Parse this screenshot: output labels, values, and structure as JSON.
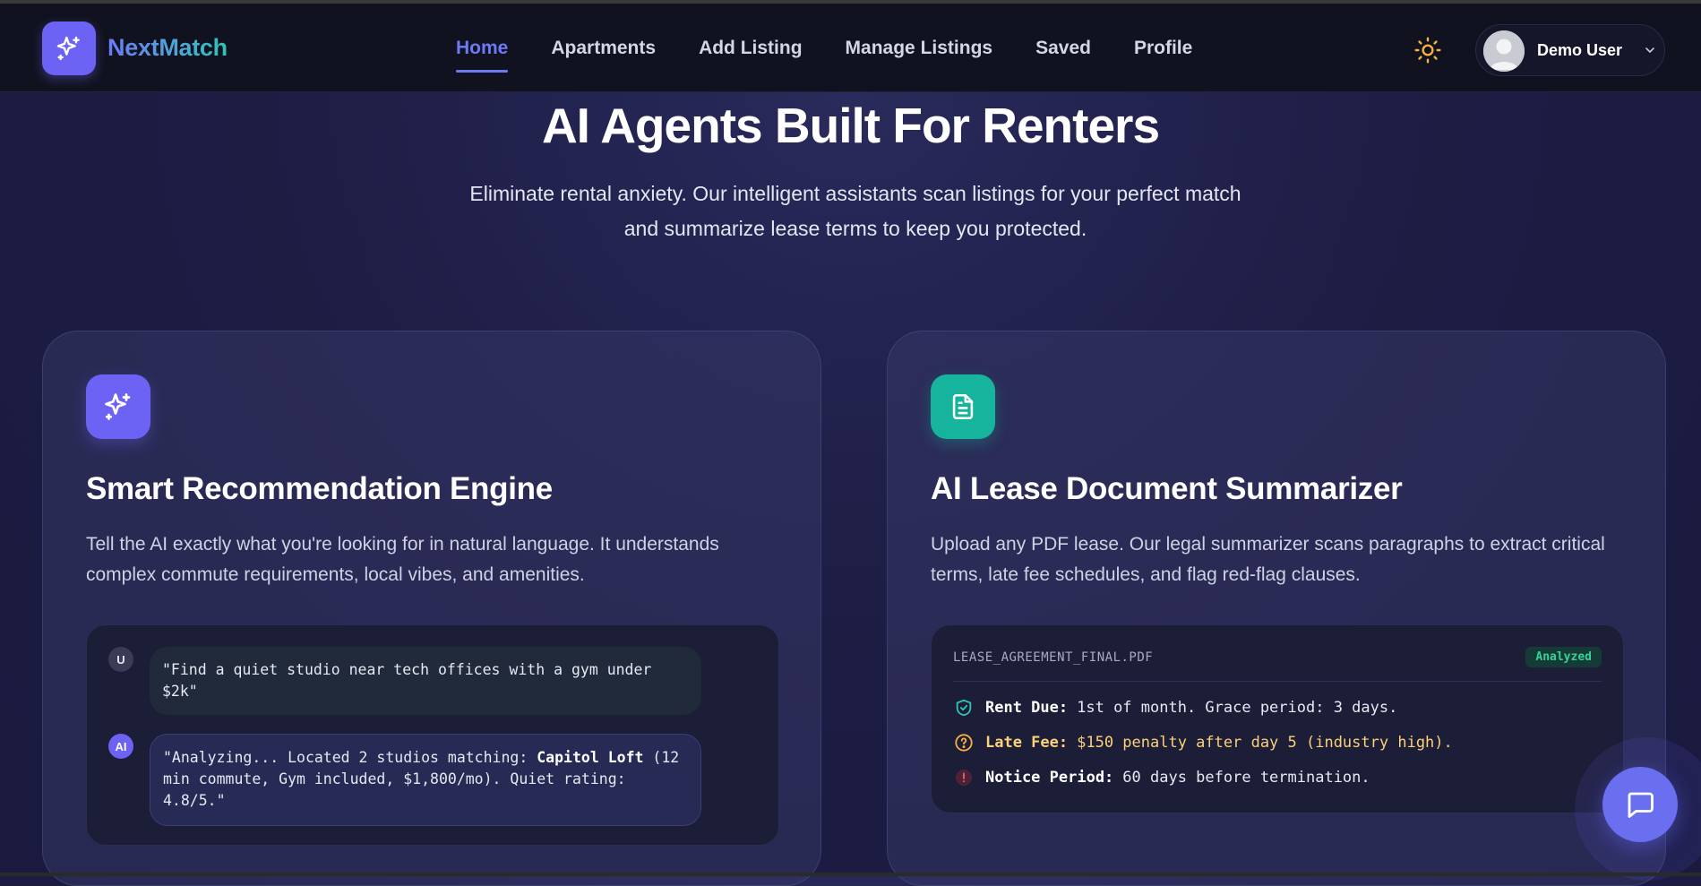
{
  "brand": {
    "name": "NextMatch"
  },
  "nav": {
    "links": [
      "Home",
      "Apartments",
      "Add Listing",
      "Manage Listings",
      "Saved",
      "Profile"
    ],
    "active": "Home"
  },
  "user": {
    "name": "Demo User"
  },
  "hero": {
    "title": "AI Agents Built For Renters",
    "subtitle": "Eliminate rental anxiety. Our intelligent assistants scan listings for your perfect match and summarize lease terms to keep you protected."
  },
  "cards": {
    "recommend": {
      "title": "Smart Recommendation Engine",
      "description": "Tell the AI exactly what you're looking for in natural language. It understands complex commute requirements, local vibes, and amenities.",
      "chat": {
        "user_badge": "U",
        "user_message": "\"Find a quiet studio near tech offices with a gym under $2k\"",
        "ai_badge": "AI",
        "ai_message_prefix": "\"Analyzing... Located 2 studios matching: ",
        "ai_message_highlight": "Capitol Loft",
        "ai_message_suffix": " (12 min commute, Gym included, $1,800/mo). Quiet rating: 4.8/5.\""
      }
    },
    "lease": {
      "title": "AI Lease Document Summarizer",
      "description": "Upload any PDF lease. Our legal summarizer scans paragraphs to extract critical terms, late fee schedules, and flag red-flag clauses.",
      "file_name": "LEASE_AGREEMENT_FINAL.PDF",
      "status": "Analyzed",
      "rows": [
        {
          "label": "Rent Due:",
          "value": "1st of month. Grace period: 3 days.",
          "icon": "shield-check-icon"
        },
        {
          "label": "Late Fee:",
          "value": "$150 penalty after day 5 (industry high).",
          "icon": "question-circle-icon"
        },
        {
          "label": "Notice Period:",
          "value": "60 days before termination.",
          "icon": "alert-circle-icon"
        }
      ]
    }
  },
  "colors": {
    "accent": "#6c63f5",
    "teal": "#17b49d",
    "warning": "#fcd07b",
    "success": "#34d399"
  }
}
